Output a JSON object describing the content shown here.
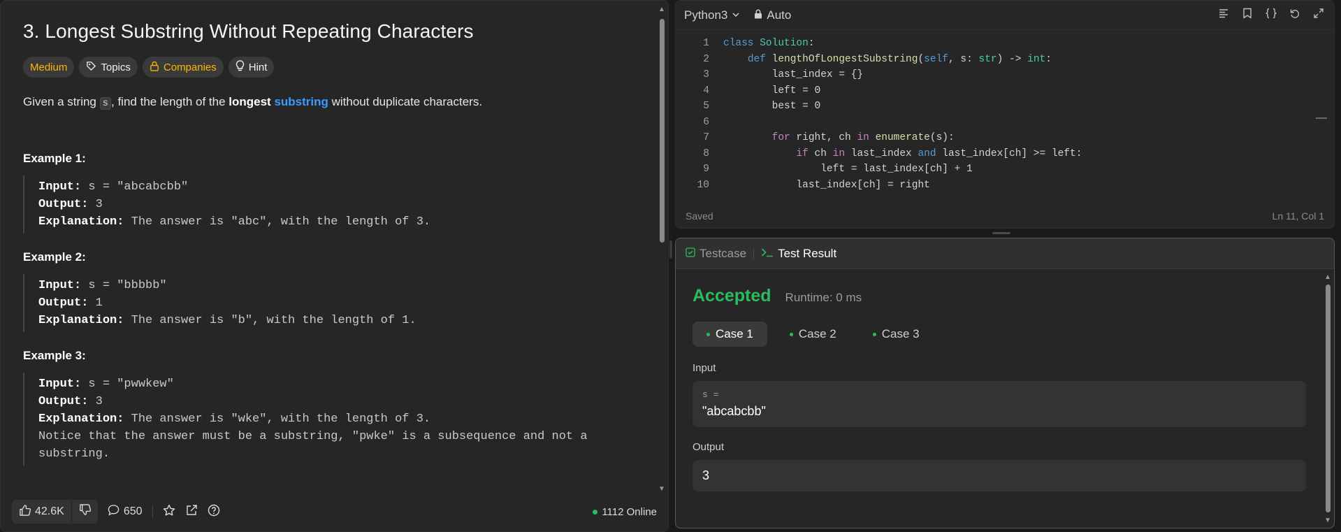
{
  "problem": {
    "title": "3. Longest Substring Without Repeating Characters",
    "tags": {
      "difficulty": "Medium",
      "topics": "Topics",
      "companies": "Companies",
      "hint": "Hint"
    },
    "description": {
      "p1": "Given a string ",
      "code": "s",
      "p2": ", find the length of the ",
      "bold": "longest",
      "space": " ",
      "link": "substring",
      "p3": " without duplicate characters."
    },
    "examples": [
      {
        "title": "Example 1:",
        "input_label": "Input:",
        "input": " s = \"abcabcbb\"",
        "output_label": "Output:",
        "output": " 3",
        "explanation_label": "Explanation:",
        "explanation": " The answer is \"abc\", with the length of 3."
      },
      {
        "title": "Example 2:",
        "input_label": "Input:",
        "input": " s = \"bbbbb\"",
        "output_label": "Output:",
        "output": " 1",
        "explanation_label": "Explanation:",
        "explanation": " The answer is \"b\", with the length of 1."
      },
      {
        "title": "Example 3:",
        "input_label": "Input:",
        "input": " s = \"pwwkew\"",
        "output_label": "Output:",
        "output": " 3",
        "explanation_label": "Explanation:",
        "explanation": " The answer is \"wke\", with the length of 3.",
        "note": "Notice that the answer must be a substring, \"pwke\" is a subsequence and not a substring."
      }
    ]
  },
  "footer": {
    "likes": "42.6K",
    "comments": "650",
    "online": "1112 Online"
  },
  "editor": {
    "language": "Python3",
    "mode": "Auto",
    "status": "Saved",
    "cursor": "Ln 11, Col 1",
    "lines": [
      "1",
      "2",
      "3",
      "4",
      "5",
      "6",
      "7",
      "8",
      "9",
      "10"
    ]
  },
  "result": {
    "tab_testcase": "Testcase",
    "tab_result": "Test Result",
    "status": "Accepted",
    "runtime": "Runtime: 0 ms",
    "cases": [
      "Case 1",
      "Case 2",
      "Case 3"
    ],
    "input_label": "Input",
    "input_var": "s =",
    "input_value": "\"abcabcbb\"",
    "output_label": "Output",
    "output_value": "3"
  },
  "colors": {
    "accent_green": "#2cbb5d",
    "medium_yellow": "#ffb800",
    "link_blue": "#3b9bff"
  }
}
